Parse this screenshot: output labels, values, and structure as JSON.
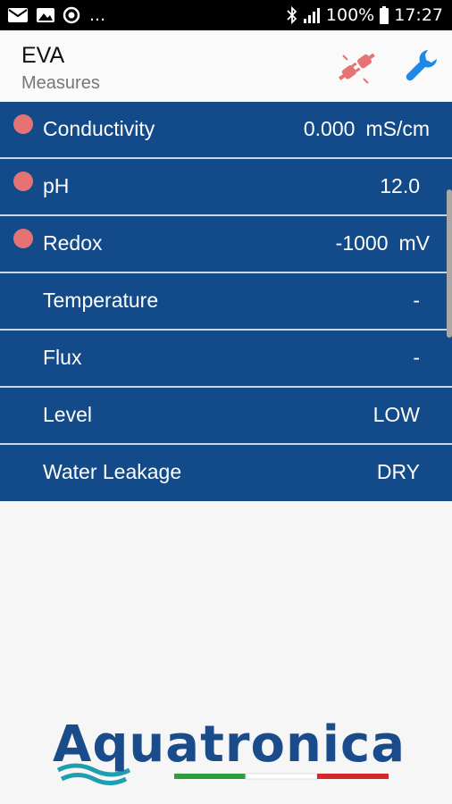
{
  "status_bar": {
    "battery": "100%",
    "time": "17:27",
    "more": "..."
  },
  "app_bar": {
    "title": "EVA",
    "subtitle": "Measures"
  },
  "measures": [
    {
      "label": "Conductivity",
      "value": "0.000",
      "unit": "mS/cm",
      "alarm": true
    },
    {
      "label": "pH",
      "value": "12.0",
      "unit": "",
      "alarm": true
    },
    {
      "label": "Redox",
      "value": "-1000",
      "unit": "mV",
      "alarm": true
    },
    {
      "label": "Temperature",
      "value": "-",
      "unit": "",
      "alarm": false
    },
    {
      "label": "Flux",
      "value": "-",
      "unit": "",
      "alarm": false
    },
    {
      "label": "Level",
      "value": "LOW",
      "unit": "",
      "alarm": false
    },
    {
      "label": "Water Leakage",
      "value": "DRY",
      "unit": "",
      "alarm": false
    }
  ],
  "logo": {
    "text": "Aquatronica"
  },
  "colors": {
    "row_bg": "#124a8a",
    "alarm_dot": "#e57373",
    "wrench": "#1e88e5",
    "plug": "#e57373"
  },
  "icons": {
    "plug": "plug-disconnected-icon",
    "wrench": "wrench-icon"
  }
}
